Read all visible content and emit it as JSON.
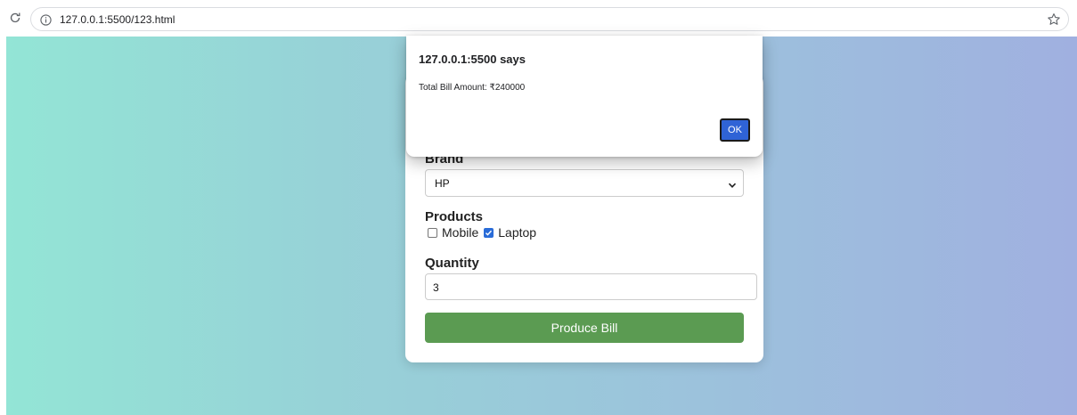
{
  "browser": {
    "url": "127.0.0.1:5500/123.html",
    "icons": {
      "reload": "reload-icon",
      "info": "info-icon",
      "bookmark": "star-icon"
    }
  },
  "form": {
    "brand_label": "Brand",
    "brand_selected": "HP",
    "products_label": "Products",
    "products": [
      {
        "label": "Mobile",
        "checked": false
      },
      {
        "label": "Laptop",
        "checked": true
      }
    ],
    "quantity_label": "Quantity",
    "quantity_value": "3",
    "submit_label": "Produce Bill"
  },
  "alert": {
    "title": "127.0.0.1:5500 says",
    "message": "Total Bill Amount: ₹240000",
    "ok_label": "OK"
  },
  "colors": {
    "button_green": "#5b9b52",
    "ok_blue": "#2f63d6",
    "checkbox_blue": "#2a6cd8",
    "gradient_start": "#93e5d6",
    "gradient_end": "#a0b0e0"
  }
}
